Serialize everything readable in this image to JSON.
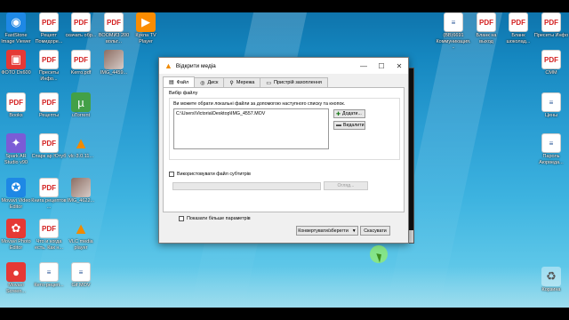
{
  "desktop": {
    "left_icons": [
      {
        "label": "FastStone Image Viewer",
        "icon": "faststone-icon",
        "kind": "app-blue",
        "glyph": "◉"
      },
      {
        "label": "Рецепт Помидоре...",
        "icon": "pdf-icon",
        "kind": "pdf",
        "glyph": "PDF"
      },
      {
        "label": "скачать обр...",
        "icon": "pdf-icon",
        "kind": "pdf",
        "glyph": "PDF"
      },
      {
        "label": "ВООМИ3 200 вольт...",
        "icon": "pdf-icon",
        "kind": "pdf",
        "glyph": "PDF"
      },
      {
        "label": "Кукла TV Player",
        "icon": "fox-icon",
        "kind": "app-orange",
        "glyph": "▶"
      },
      {
        "label": "ФОТО Dx600",
        "icon": "photo-icon",
        "kind": "app-red",
        "glyph": "▣"
      },
      {
        "label": "Пресеты Инфо...",
        "icon": "pdf-icon",
        "kind": "pdf",
        "glyph": "PDF"
      },
      {
        "label": "Kerro.pdf",
        "icon": "pdf-icon",
        "kind": "pdf",
        "glyph": "PDF"
      },
      {
        "label": "IMG_4459...",
        "icon": "image-icon",
        "kind": "app-photo",
        "glyph": ""
      },
      {
        "label": "Books",
        "icon": "folder-icon",
        "kind": "pdf",
        "glyph": "PDF"
      },
      {
        "label": "Рецепты",
        "icon": "pdf-icon",
        "kind": "pdf",
        "glyph": "PDF"
      },
      {
        "label": "uTorrent",
        "icon": "utorrent-icon",
        "kind": "app-green",
        "glyph": "µ"
      },
      {
        "label": "Spark AR Studio v90",
        "icon": "spark-ar-icon",
        "kind": "app-purple",
        "glyph": "✦"
      },
      {
        "label": "Спарк ар Ютуб",
        "icon": "pdf-icon",
        "kind": "pdf",
        "glyph": "PDF"
      },
      {
        "label": "vlc-3.0.11...",
        "icon": "vlc-icon",
        "kind": "vlc",
        "glyph": "▲"
      },
      {
        "label": "Movavi Video Editor",
        "icon": "movavi-icon",
        "kind": "app-blue",
        "glyph": "✪"
      },
      {
        "label": "Книга рецептов ...",
        "icon": "pdf-icon",
        "kind": "pdf",
        "glyph": "PDF"
      },
      {
        "label": "IMG_4622...",
        "icon": "image-icon",
        "kind": "app-photo",
        "glyph": ""
      },
      {
        "label": "Movavi Photo Editor",
        "icon": "movavi-photo-icon",
        "kind": "app-red",
        "glyph": "✿"
      },
      {
        "label": "Что и когда есть. Как н...",
        "icon": "pdf-icon",
        "kind": "pdf",
        "glyph": "PDF"
      },
      {
        "label": "VLC media player",
        "icon": "vlc-icon",
        "kind": "vlc",
        "glyph": "▲"
      },
      {
        "label": "Movavi Screen...",
        "icon": "movavi-screen-icon",
        "kind": "app-red",
        "glyph": "●"
      },
      {
        "label": "Кето-рецеп...",
        "icon": "doc-icon",
        "kind": "doc",
        "glyph": "≡"
      },
      {
        "label": "Gif MOV",
        "icon": "doc-icon",
        "kind": "doc",
        "glyph": "≡"
      }
    ],
    "right_icons": [
      {
        "label": "(ВВ)6691 Коммуникация...",
        "icon": "doc-icon",
        "kind": "doc",
        "glyph": "≡"
      },
      {
        "label": "Бланк на выход",
        "icon": "pdf-icon",
        "kind": "pdf",
        "glyph": "PDF"
      },
      {
        "label": "Бланк шоколад...",
        "icon": "pdf-icon",
        "kind": "pdf",
        "glyph": "PDF"
      },
      {
        "label": "Пресеты Инфо",
        "icon": "pdf-icon",
        "kind": "pdf",
        "glyph": "PDF"
      },
      {
        "label": "CMM",
        "icon": "pdf-icon",
        "kind": "pdf",
        "glyph": "PDF"
      },
      {
        "label": "Цены",
        "icon": "doc-icon",
        "kind": "doc",
        "glyph": "≡"
      },
      {
        "label": "Пароль Аюрведа...",
        "icon": "doc-icon",
        "kind": "doc",
        "glyph": "≡"
      },
      {
        "label": "Корзина",
        "icon": "recycle-bin-icon",
        "kind": "bin",
        "glyph": "♻"
      }
    ]
  },
  "vlc_dialog": {
    "title": "Відкрити медіа",
    "tabs": [
      {
        "label": "Файл",
        "icon": "file-icon",
        "glyph": "▤"
      },
      {
        "label": "Диск",
        "icon": "disc-icon",
        "glyph": "◎"
      },
      {
        "label": "Мережа",
        "icon": "network-icon",
        "glyph": "⚲"
      },
      {
        "label": "Пристрій захоплення",
        "icon": "capture-device-icon",
        "glyph": "▭"
      }
    ],
    "file_group_label": "Вибір файлу",
    "hint": "Ви можете обрати локальні файли за допомогою наступного списку та кнопок.",
    "files": [
      "C:\\Users\\Victoria\\Desktop\\IMG_4557.MOV"
    ],
    "add_label": "Додати...",
    "remove_label": "Видалити",
    "subtitle_label": "Використовувати файл субтитрів",
    "browse_label": "Огляд...",
    "show_more_label": "Показати більше параметрів",
    "convert_label": "Конвертувати/зберегти",
    "cancel_label": "Скасувати",
    "accent": "#f08a00"
  }
}
